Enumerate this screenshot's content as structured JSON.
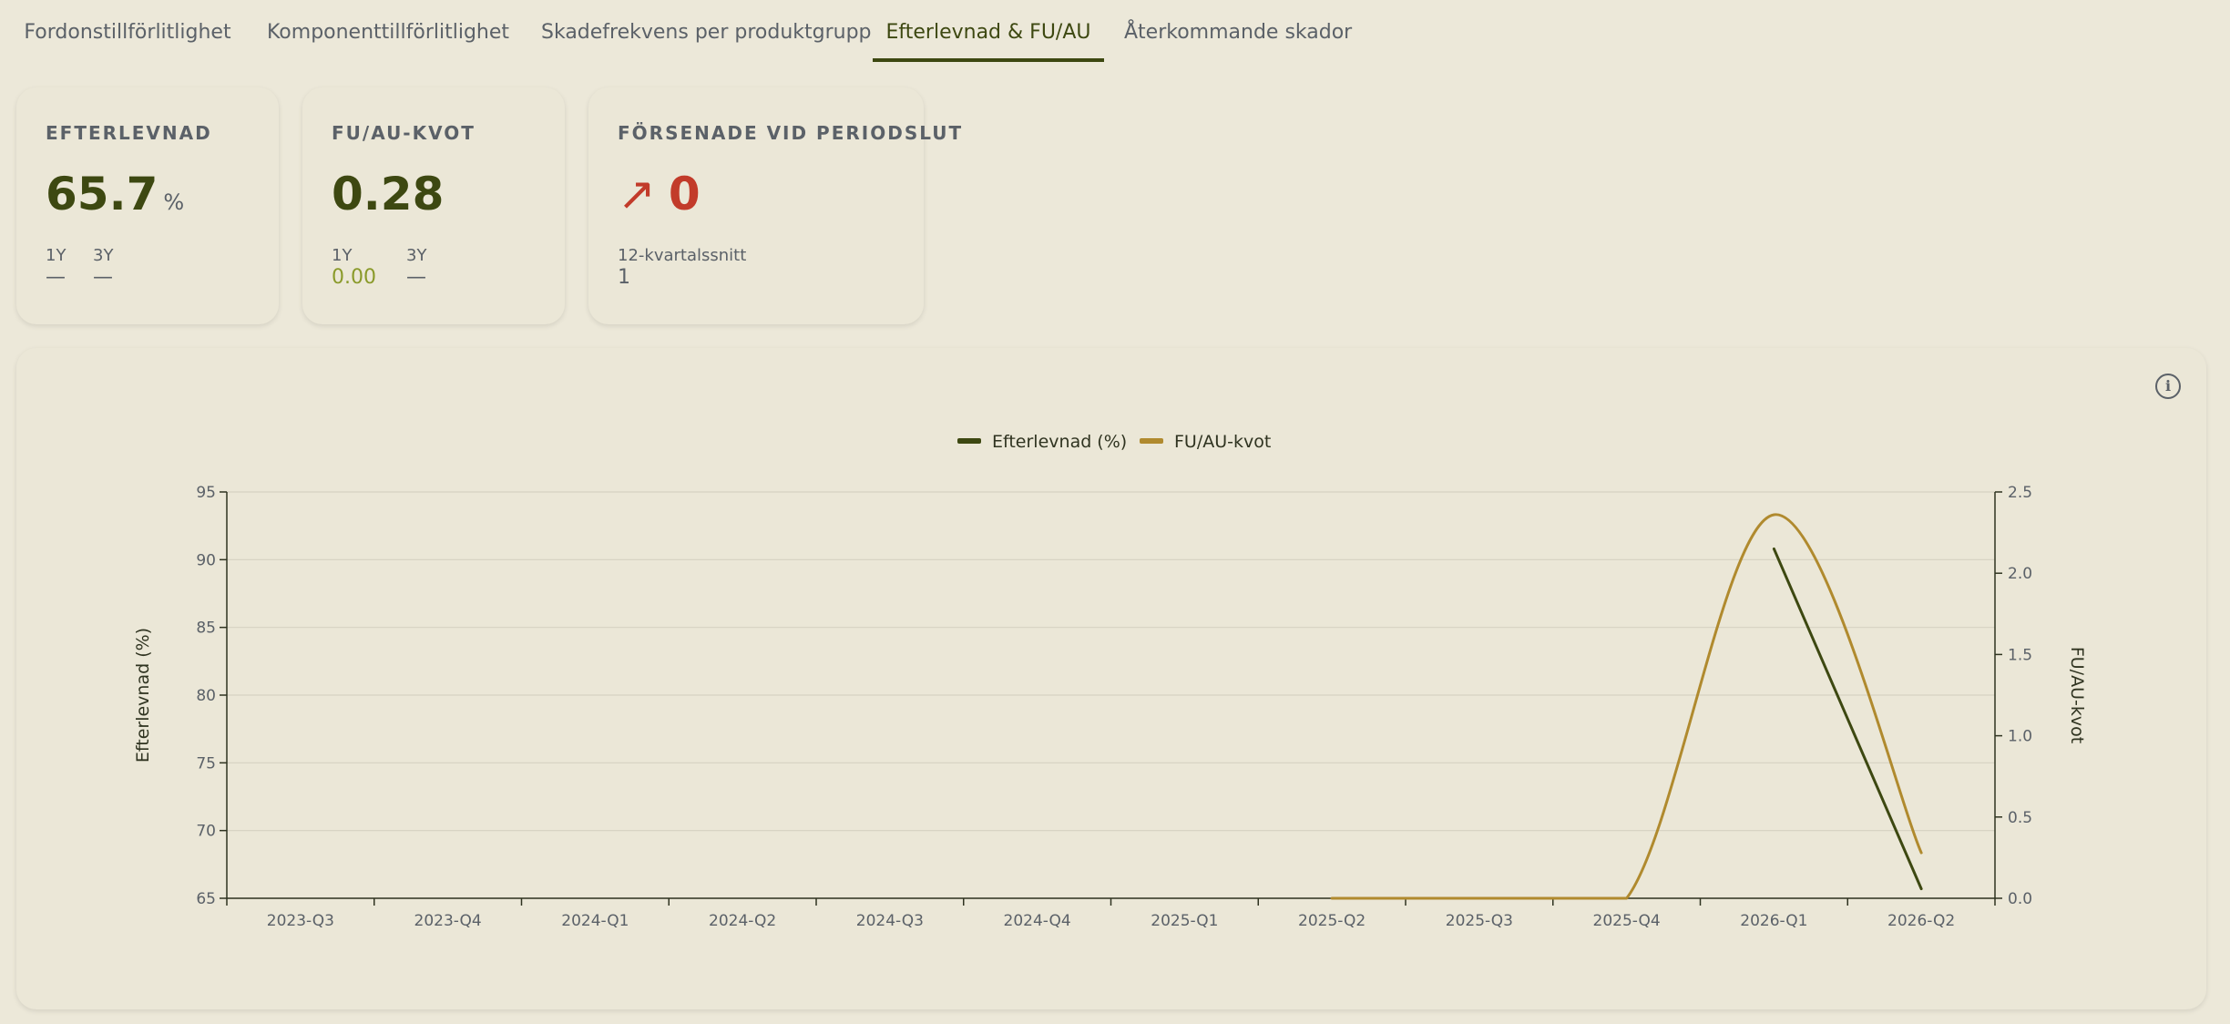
{
  "tabs": [
    {
      "label": "Fordonstillförlitlighet",
      "active": false
    },
    {
      "label": "Komponenttillförlitlighet",
      "active": false
    },
    {
      "label": "Skadefrekvens per produktgrupp",
      "active": false
    },
    {
      "label": "Efterlevnad & FU/AU",
      "active": true
    },
    {
      "label": "Återkommande skador",
      "active": false
    }
  ],
  "cards": {
    "efterlevnad": {
      "title": "EFTERLEVNAD",
      "value": "65.7",
      "unit": "%",
      "sub": [
        {
          "label": "1Y",
          "value": "—"
        },
        {
          "label": "3Y",
          "value": "—"
        }
      ]
    },
    "fuau": {
      "title": "FU/AU-KVOT",
      "value": "0.28",
      "sub": [
        {
          "label": "1Y",
          "value": "0.00"
        },
        {
          "label": "3Y",
          "value": "—"
        }
      ]
    },
    "forsenade": {
      "title": "FÖRSENADE VID PERIODSLUT",
      "arrow": "↗",
      "value": "0",
      "sub_label": "12-kvartalssnitt",
      "sub_value": "1"
    }
  },
  "info_icon": "info-icon",
  "colors": {
    "efterlevnad": "#3d4811",
    "fuau": "#b08a2e",
    "danger": "#c23b2a"
  },
  "chart_data": {
    "type": "line",
    "categories": [
      "2023-Q3",
      "2023-Q4",
      "2024-Q1",
      "2024-Q2",
      "2024-Q3",
      "2024-Q4",
      "2025-Q1",
      "2025-Q2",
      "2025-Q3",
      "2025-Q4",
      "2026-Q1",
      "2026-Q2"
    ],
    "series": [
      {
        "name": "Efterlevnad (%)",
        "axis": "left",
        "color": "#3d4811",
        "values": [
          null,
          null,
          null,
          null,
          null,
          null,
          null,
          null,
          null,
          null,
          90.8,
          65.7
        ]
      },
      {
        "name": "FU/AU-kvot",
        "axis": "right",
        "color": "#b08a2e",
        "smooth": true,
        "values": [
          null,
          null,
          null,
          null,
          null,
          null,
          null,
          0.0,
          0.0,
          0.0,
          2.36,
          0.28
        ]
      }
    ],
    "ylabel_left": "Efterlevnad (%)",
    "ylabel_right": "FU/AU-kvot",
    "ylim_left": [
      65,
      95
    ],
    "yticks_left": [
      65,
      70,
      75,
      80,
      85,
      90,
      95
    ],
    "ylim_right": [
      0,
      2.5
    ],
    "yticks_right": [
      "0.0",
      "0.5",
      "1.0",
      "1.5",
      "2.0",
      "2.5"
    ],
    "legend_position": "top-center",
    "grid": true
  }
}
